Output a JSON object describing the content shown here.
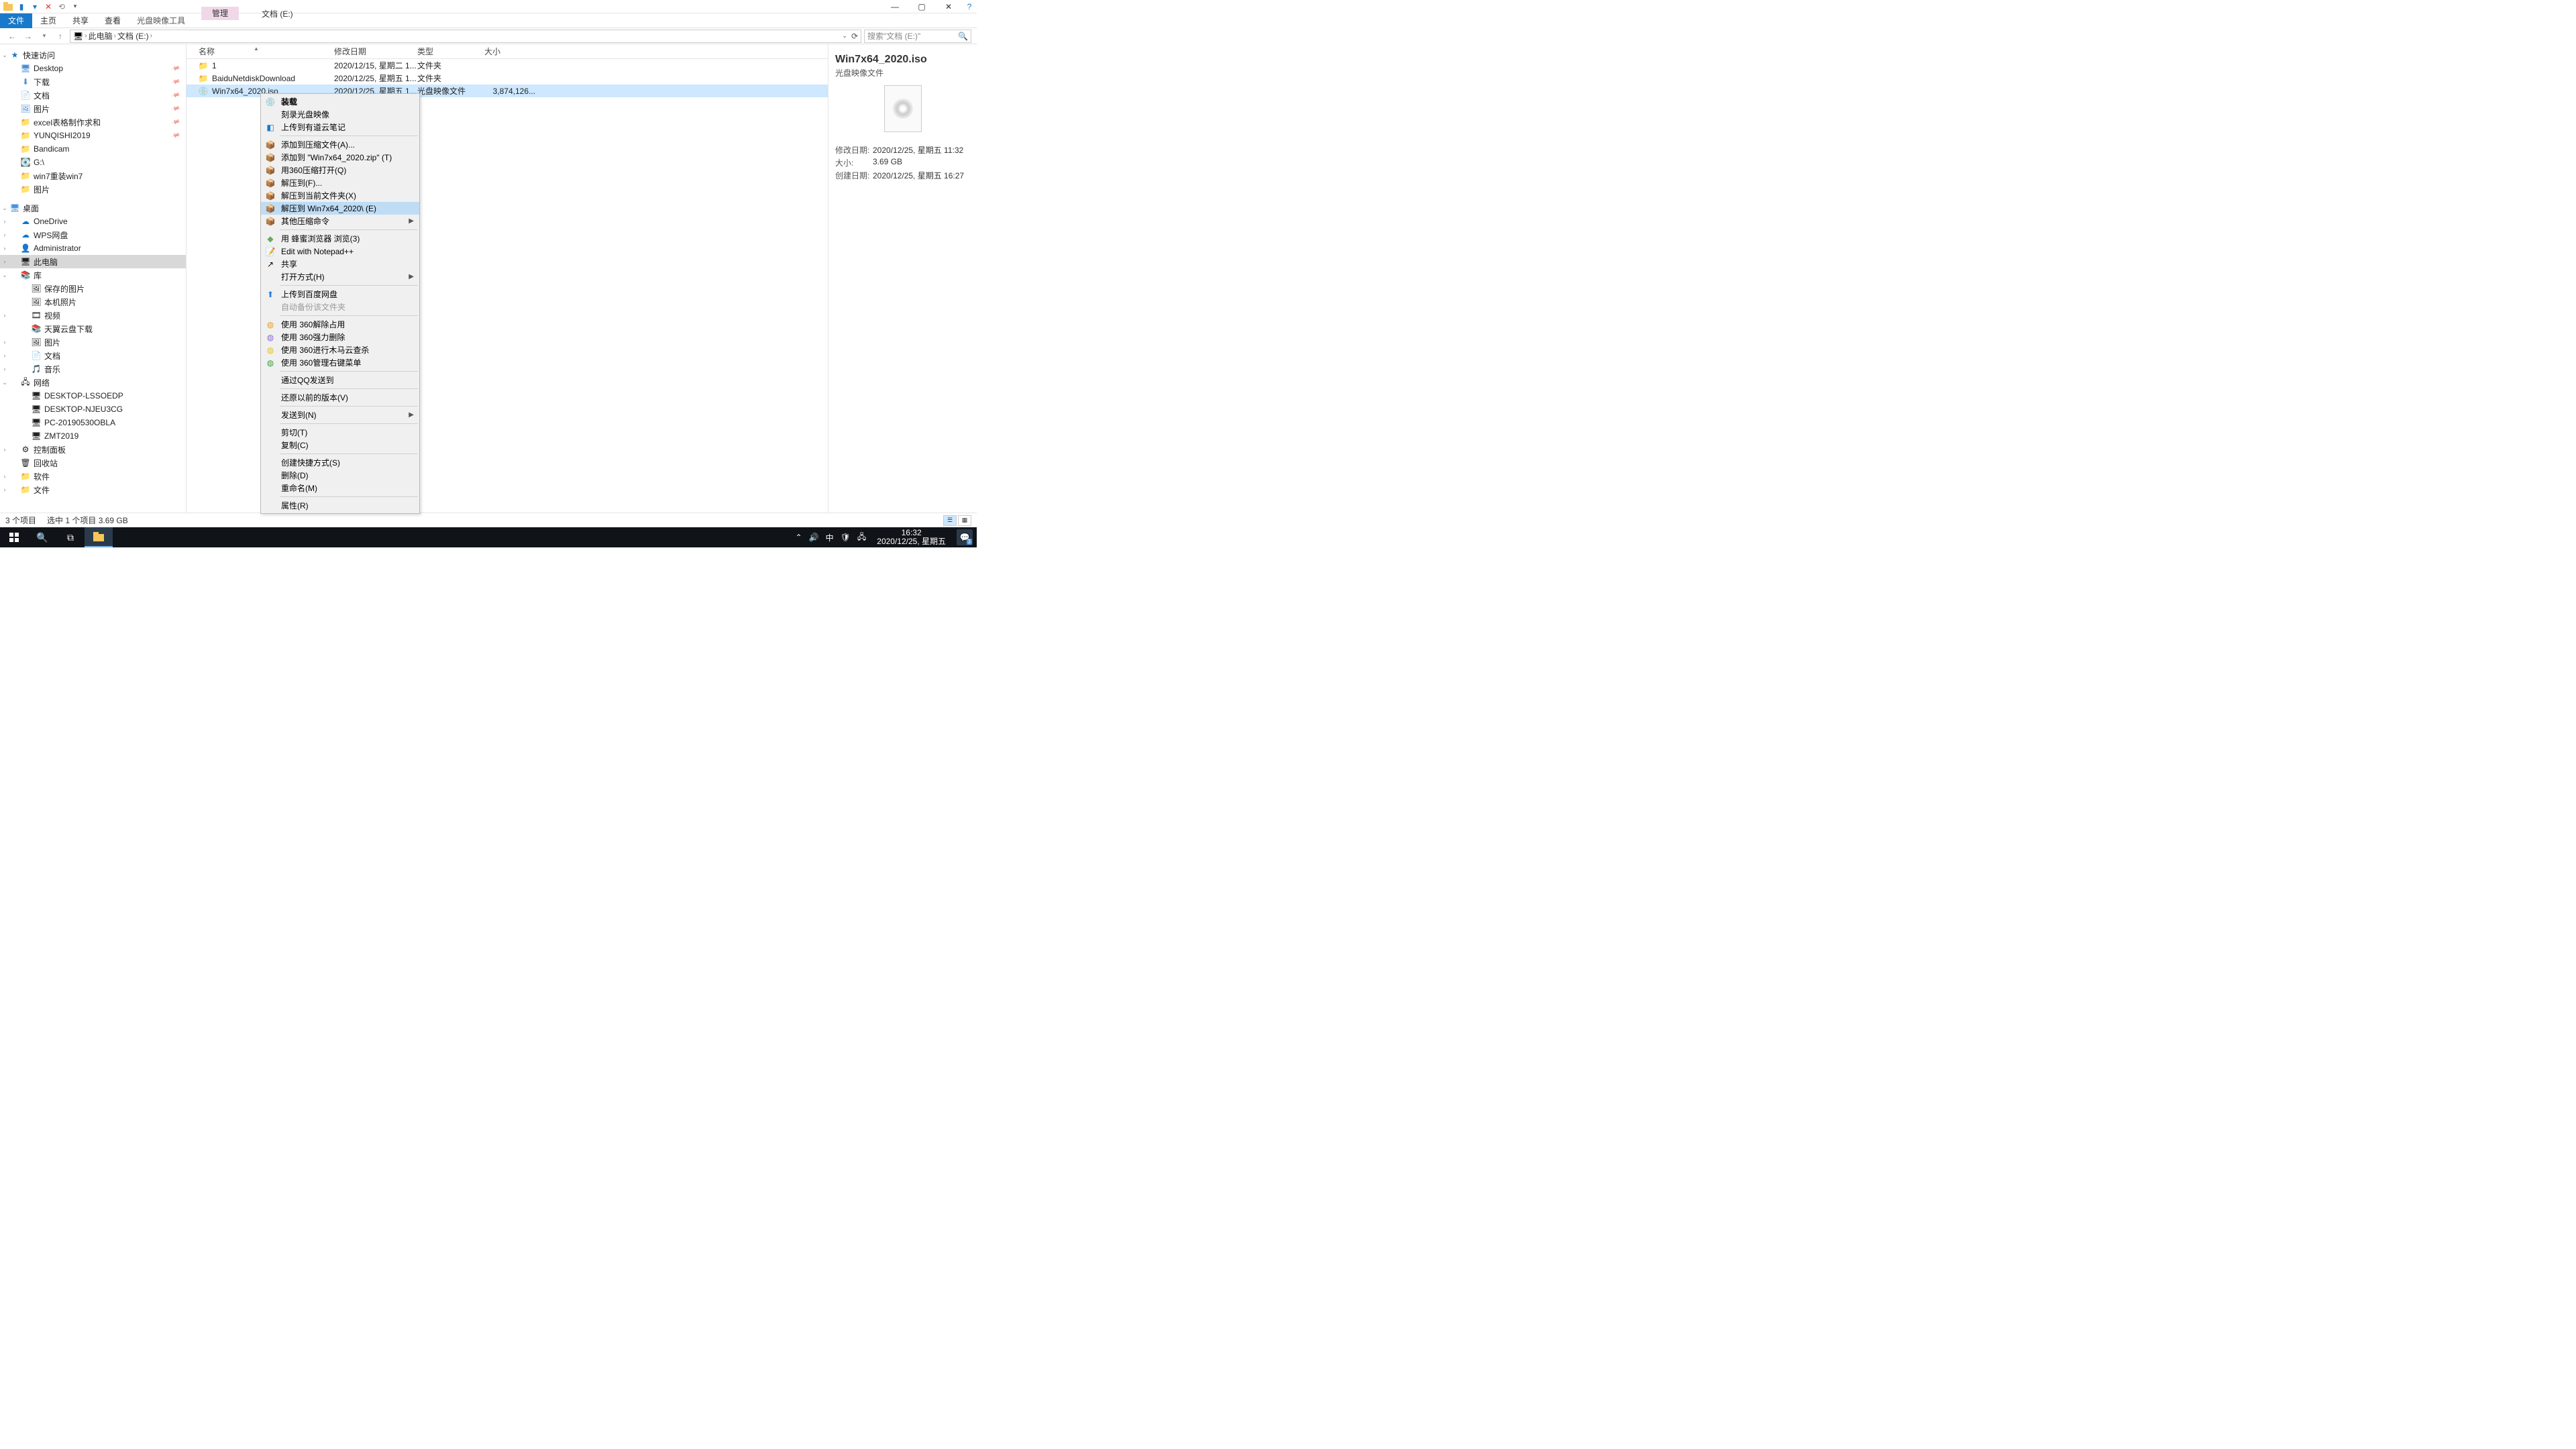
{
  "window": {
    "mgmt_tab": "管理",
    "title": "文档 (E:)"
  },
  "ribbon": {
    "file": "文件",
    "home": "主页",
    "share": "共享",
    "view": "查看",
    "iso_tools": "光盘映像工具"
  },
  "addr": {
    "this_pc": "此电脑",
    "drive": "文档 (E:)"
  },
  "search": {
    "placeholder": "搜索\"文档 (E:)\""
  },
  "tree": {
    "quick": "快速访问",
    "desktop": "Desktop",
    "downloads": "下载",
    "documents": "文档",
    "pictures": "图片",
    "excel": "excel表格制作求和",
    "yunqishi": "YUNQISHI2019",
    "bandicam": "Bandicam",
    "gdrive": "G:\\",
    "win7re": "win7重装win7",
    "pictures2": "图片",
    "desktop_cn": "桌面",
    "onedrive": "OneDrive",
    "wps": "WPS网盘",
    "admin": "Administrator",
    "thispc": "此电脑",
    "libraries": "库",
    "saved_pics": "保存的图片",
    "camera_roll": "本机照片",
    "videos": "视频",
    "tianyi": "天翼云盘下载",
    "pics_lib": "图片",
    "docs_lib": "文档",
    "music": "音乐",
    "network": "网络",
    "pc1": "DESKTOP-LSSOEDP",
    "pc2": "DESKTOP-NJEU3CG",
    "pc3": "PC-20190530OBLA",
    "pc4": "ZMT2019",
    "ctrlpanel": "控制面板",
    "recycle": "回收站",
    "software": "软件",
    "files": "文件"
  },
  "cols": {
    "name": "名称",
    "date": "修改日期",
    "type": "类型",
    "size": "大小"
  },
  "rows": [
    {
      "icon": "folder",
      "name": "1",
      "date": "2020/12/15, 星期二 1...",
      "type": "文件夹",
      "size": ""
    },
    {
      "icon": "folder",
      "name": "BaiduNetdiskDownload",
      "date": "2020/12/25, 星期五 1...",
      "type": "文件夹",
      "size": ""
    },
    {
      "icon": "iso",
      "name": "Win7x64_2020.iso",
      "date": "2020/12/25, 星期五 1...",
      "type": "光盘映像文件",
      "size": "3,874,126..."
    }
  ],
  "details": {
    "title": "Win7x64_2020.iso",
    "subtitle": "光盘映像文件",
    "mod_k": "修改日期:",
    "mod_v": "2020/12/25, 星期五 11:32",
    "size_k": "大小:",
    "size_v": "3.69 GB",
    "created_k": "创建日期:",
    "created_v": "2020/12/25, 星期五 16:27"
  },
  "status": {
    "count": "3 个项目",
    "sel": "选中 1 个项目  3.69 GB"
  },
  "ctx": {
    "mount": "装载",
    "burn": "刻录光盘映像",
    "youdao": "上传到有道云笔记",
    "addzip": "添加到压缩文件(A)...",
    "addtozip": "添加到 \"Win7x64_2020.zip\" (T)",
    "open360zip": "用360压缩打开(Q)",
    "extractto": "解压到(F)...",
    "extracthere": "解压到当前文件夹(X)",
    "extractdir": "解压到 Win7x64_2020\\ (E)",
    "otherzip": "其他压缩命令",
    "honey": "用 蜂蜜浏览器 浏览(3)",
    "notepad": "Edit with Notepad++",
    "share": "共享",
    "openwith": "打开方式(H)",
    "baidu": "上传到百度网盘",
    "autobackup": "自动备份该文件夹",
    "unlock360": "使用 360解除占用",
    "delete360": "使用 360强力删除",
    "scan360": "使用 360进行木马云查杀",
    "menu360": "使用 360管理右键菜单",
    "qqsend": "通过QQ发送到",
    "restore": "还原以前的版本(V)",
    "sendto": "发送到(N)",
    "cut": "剪切(T)",
    "copy": "复制(C)",
    "shortcut": "创建快捷方式(S)",
    "delete": "删除(D)",
    "rename": "重命名(M)",
    "props": "属性(R)"
  },
  "taskbar": {
    "ime": "中",
    "time": "16:32",
    "date": "2020/12/25, 星期五",
    "notif_count": "3"
  }
}
